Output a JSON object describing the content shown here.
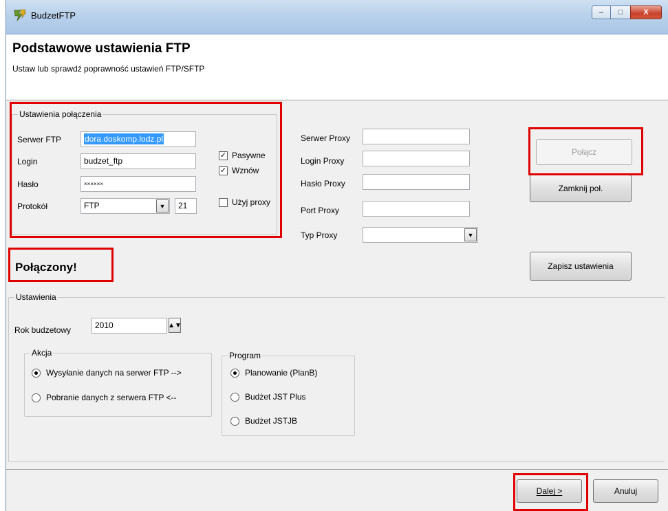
{
  "window": {
    "title": "BudzetFTP",
    "controls": {
      "minimize": "–",
      "maximize": "□",
      "close": "X"
    }
  },
  "header": {
    "title": "Podstawowe ustawienia FTP",
    "subtitle": "Ustaw lub sprawdź poprawność ustawień FTP/SFTP"
  },
  "connection": {
    "group_label": "Ustawienia połączenia",
    "server_label": "Serwer FTP",
    "server_value": "dora.doskomp.lodz.pl",
    "login_label": "Login",
    "login_value": "budzet_ftp",
    "password_label": "Hasło",
    "password_value": "××××××",
    "protocol_label": "Protokół",
    "protocol_value": "FTP",
    "port_value": "21",
    "passive_label": "Pasywne",
    "passive_checked": true,
    "resume_label": "Wznów",
    "resume_checked": true,
    "use_proxy_label": "Użyj proxy",
    "use_proxy_checked": false
  },
  "proxy": {
    "server_label": "Serwer Proxy",
    "login_label": "Login Proxy",
    "password_label": "Hasło Proxy",
    "port_label": "Port Proxy",
    "type_label": "Typ Proxy",
    "server_value": "",
    "login_value": "",
    "password_value": "",
    "port_value": "",
    "type_value": ""
  },
  "buttons": {
    "connect": "Połącz",
    "disconnect": "Zamknij poł.",
    "save_settings": "Zapisz ustawienia",
    "next": "Dalej >",
    "cancel": "Anuluj"
  },
  "status_text": "Połączony!",
  "settings": {
    "group_label": "Ustawienia",
    "year_label": "Rok budzetowy",
    "year_value": "2010",
    "action": {
      "group_label": "Akcja",
      "options": [
        {
          "label": "Wysyłanie danych na serwer FTP -->",
          "selected": true
        },
        {
          "label": "Pobranie danych z serwera FTP   <--",
          "selected": false
        }
      ]
    },
    "program": {
      "group_label": "Program",
      "options": [
        {
          "label": "Planowanie (PlanB)",
          "selected": true
        },
        {
          "label": "Budżet JST Plus",
          "selected": false
        },
        {
          "label": "Budżet JSTJB",
          "selected": false
        }
      ]
    }
  },
  "colors": {
    "highlight_border": "#e00000",
    "selection": "#3399ff",
    "dialog_bg": "#f0f0f0"
  }
}
